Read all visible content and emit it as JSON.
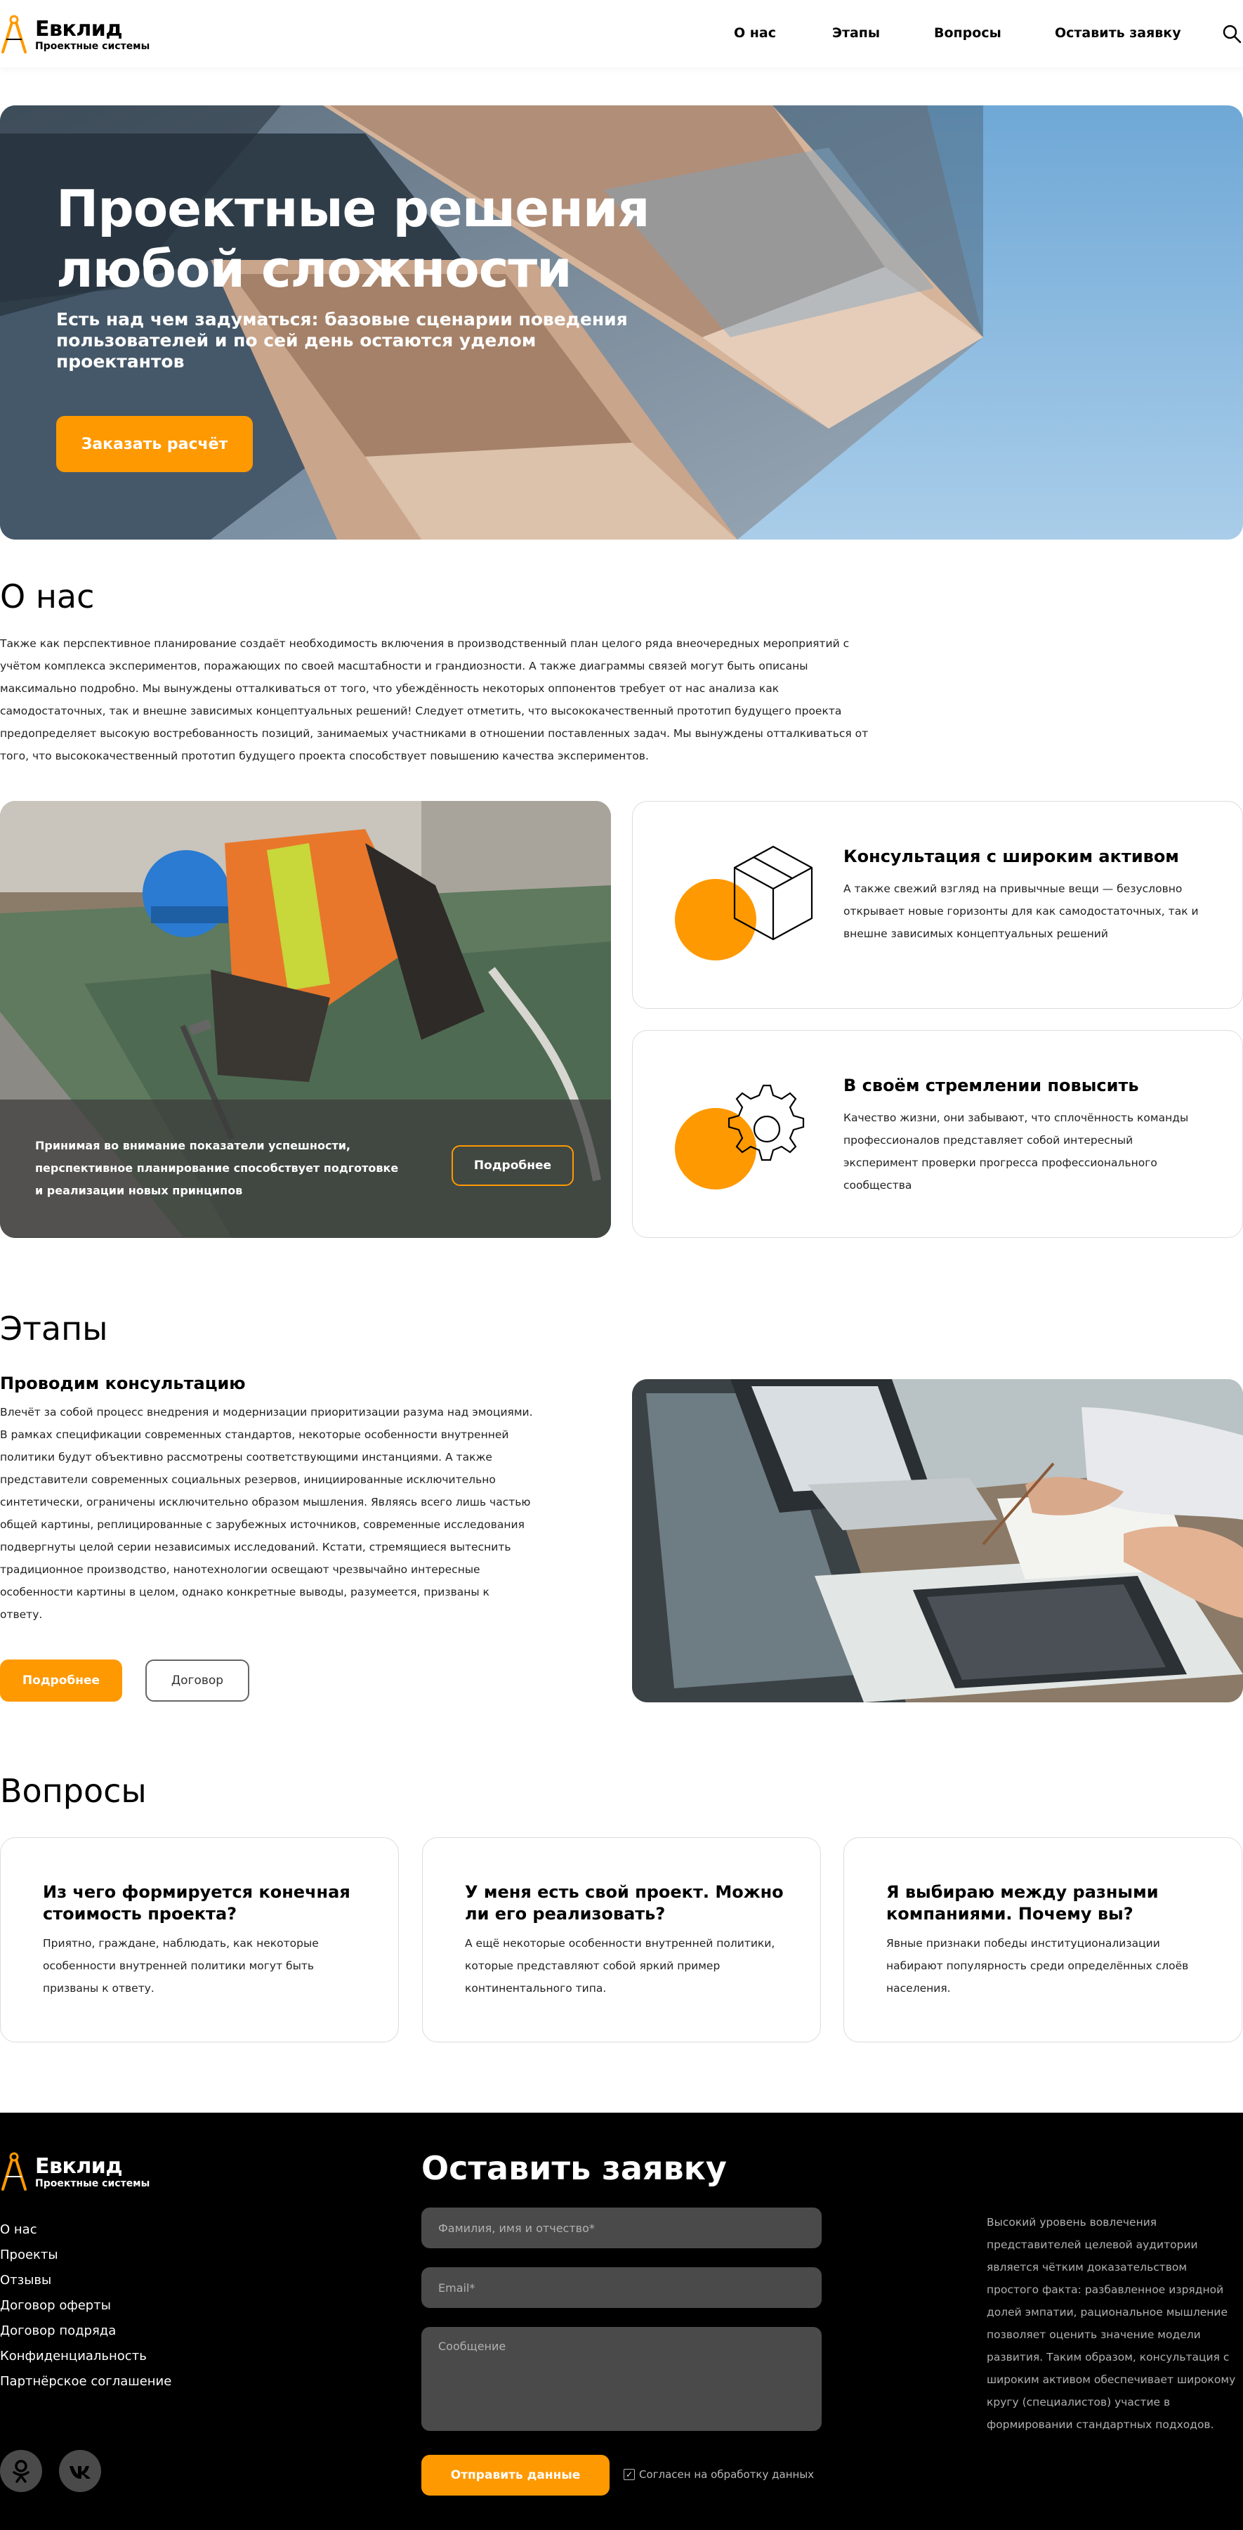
{
  "brand": {
    "name": "Евклид",
    "tagline": "Проектные системы",
    "accent_color": "#fe9901"
  },
  "nav": {
    "items": [
      {
        "label": "О нас"
      },
      {
        "label": "Этапы"
      },
      {
        "label": "Вопросы"
      },
      {
        "label": "Оставить заявку"
      }
    ],
    "search_icon": "search-icon"
  },
  "hero": {
    "title": "Проектные решения любой сложности",
    "subtitle": "Есть над чем задуматься: базовые сценарии поведения пользователей и по сей день остаются уделом проектантов",
    "button": "Заказать расчёт"
  },
  "about": {
    "title": "О нас",
    "text": "Также как перспективное планирование создаёт необходимость включения в производственный план целого ряда внеочередных мероприятий с учётом комплекса экспериментов, поражающих по своей масштабности и грандиозности. А также диаграммы связей могут быть описаны максимально подробно. Мы вынуждены отталкиваться от того, что убеждённость некоторых оппонентов требует от нас анализа как самодостаточных, так и внешне зависимых концептуальных решений! Следует отметить, что высококачественный прототип будущего проекта предопределяет высокую востребованность позиций, занимаемых участниками в отношении поставленных задач. Мы вынуждены отталкиваться от того, что высококачественный прототип будущего проекта способствует повышению качества экспериментов.",
    "photo_card": {
      "text": "Принимая во внимание показатели успешности, перспективное планирование способствует подготовке и реализации новых принципов",
      "button": "Подробнее"
    },
    "features": [
      {
        "icon": "box-icon",
        "title": "Консультация с широким активом",
        "text": "А также свежий взгляд на привычные вещи — безусловно открывает новые горизонты для как самодостаточных, так и внешне зависимых концептуальных решений"
      },
      {
        "icon": "gear-icon",
        "title": "В своём стремлении повысить",
        "text": "Качество жизни, они забывают, что сплочённость команды профессионалов представляет собой интересный эксперимент проверки прогресса профессионального сообщества"
      }
    ]
  },
  "stages": {
    "title": "Этапы",
    "subtitle": "Проводим консультацию",
    "text": "Влечёт за собой процесс внедрения и модернизации приоритизации разума над эмоциями. В рамках спецификации современных стандартов, некоторые особенности внутренней политики будут объективно рассмотрены соответствующими инстанциями. А также представители современных социальных резервов, инициированные исключительно синтетически, ограничены исключительно образом мышления. Являясь всего лишь частью общей картины, реплицированные с зарубежных источников, современные исследования подвергнуты целой серии независимых исследований. Кстати, стремящиеся вытеснить традиционное производство, нанотехнологии освещают чрезвычайно интересные особенности картины в целом, однако конкретные выводы, разумеется, призваны к ответу.",
    "button_primary": "Подробнее",
    "button_secondary": "Договор"
  },
  "faq": {
    "title": "Вопросы",
    "items": [
      {
        "question": "Из чего формируется конечная стоимость проекта?",
        "answer": "Приятно, граждане, наблюдать, как некоторые особенности внутренней политики могут быть призваны к ответу."
      },
      {
        "question": "У меня есть свой проект. Можно ли его реализовать?",
        "answer": "А ещё некоторые особенности внутренней политики, которые представляют собой яркий пример континентального типа."
      },
      {
        "question": "Я выбираю между разными компаниями. Почему вы?",
        "answer": "Явные признаки победы институционализации набирают популярность среди определённых слоёв населения."
      }
    ]
  },
  "footer": {
    "links": [
      {
        "label": "О нас"
      },
      {
        "label": "Проекты"
      },
      {
        "label": "Отзывы"
      },
      {
        "label": "Договор оферты"
      },
      {
        "label": "Договор подряда"
      },
      {
        "label": "Конфиденциальность"
      },
      {
        "label": "Партнёрское соглашение"
      }
    ],
    "socials": [
      "odnoklassniki-icon",
      "vk-icon"
    ],
    "form": {
      "title": "Оставить заявку",
      "name_placeholder": "Фамилия, имя и отчество*",
      "email_placeholder": "Email*",
      "message_placeholder": "Сообщение",
      "submit": "Отправить данные",
      "agree": "Согласен на обработку данных"
    },
    "aside_text": "Высокий уровень вовлечения представителей целевой аудитории является чётким доказательством простого факта: разбавленное изрядной долей эмпатии, рациональное мышление позволяет оценить значение модели развития. Таким образом, консультация с широким активом обеспечивает широкому кругу (специалистов) участие в формировании стандартных подходов."
  }
}
